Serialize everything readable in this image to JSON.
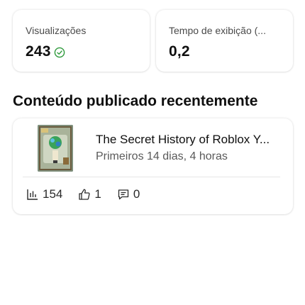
{
  "stats": {
    "views": {
      "label": "Visualizações",
      "value": "243",
      "status_icon": "check-circle-icon"
    },
    "watch_time": {
      "label": "Tempo de exibição (...",
      "value": "0,2"
    }
  },
  "section": {
    "title": "Conteúdo publicado recentemente"
  },
  "video": {
    "title": "The Secret History of Roblox Y...",
    "subtitle": "Primeiros 14 dias, 4 horas",
    "thumbnail_icon": "video-thumbnail",
    "metrics": {
      "views": "154",
      "likes": "1",
      "comments": "0"
    }
  },
  "colors": {
    "accent_check": "#2e9a3c",
    "card_bg": "#ffffff",
    "text_secondary": "#5a5a5a"
  }
}
